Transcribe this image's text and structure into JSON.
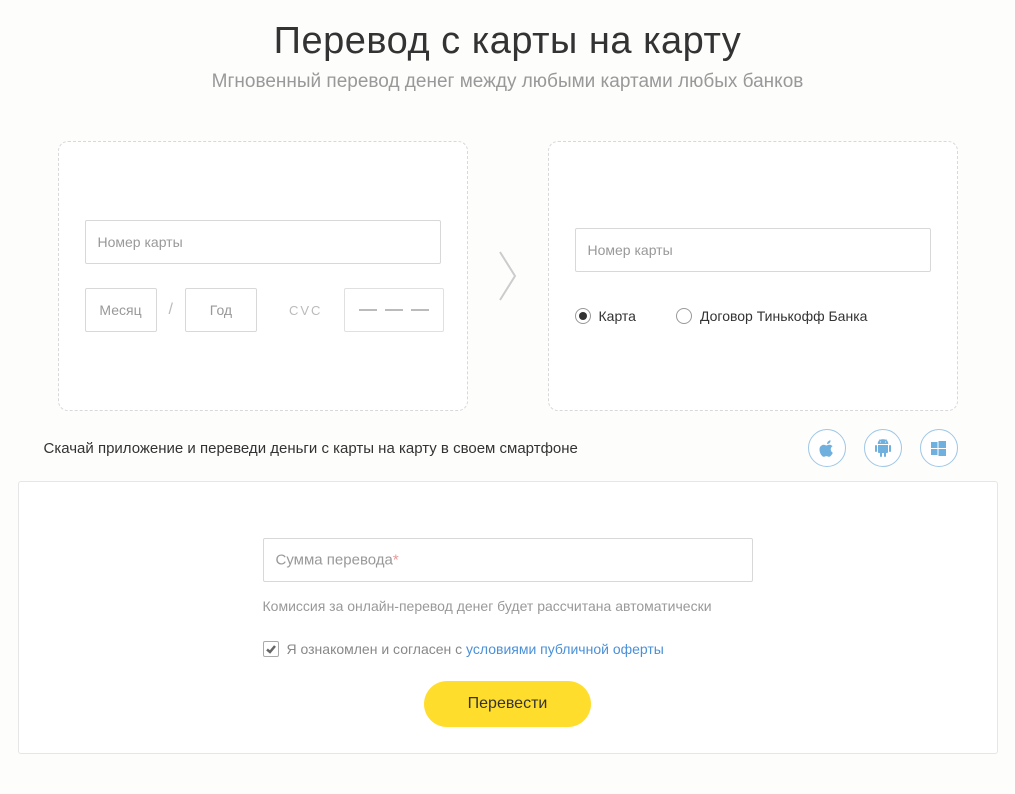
{
  "heading": "Перевод с карты на карту",
  "subtitle": "Мгновенный перевод денег между любыми картами любых банков",
  "from_card": {
    "number_placeholder": "Номер карты",
    "month_placeholder": "Месяц",
    "year_placeholder": "Год",
    "cvc_label": "CVC"
  },
  "to_card": {
    "number_placeholder": "Номер карты",
    "radio_card": "Карта",
    "radio_contract": "Договор Тинькофф Банка"
  },
  "promo": {
    "text": "Скачай приложение и переведи деньги с карты на карту в своем смартфоне",
    "apple_icon": "apple-icon",
    "android_icon": "android-icon",
    "windows_icon": "windows-icon"
  },
  "amount": {
    "placeholder_prefix": "Сумма перевода",
    "required_mark": "*",
    "commission": "Комиссия за онлайн-перевод денег будет рассчитана автоматически",
    "agree_prefix": "Я ознакомлен и согласен с ",
    "agree_link": "условиями публичной оферты",
    "submit": "Перевести"
  }
}
